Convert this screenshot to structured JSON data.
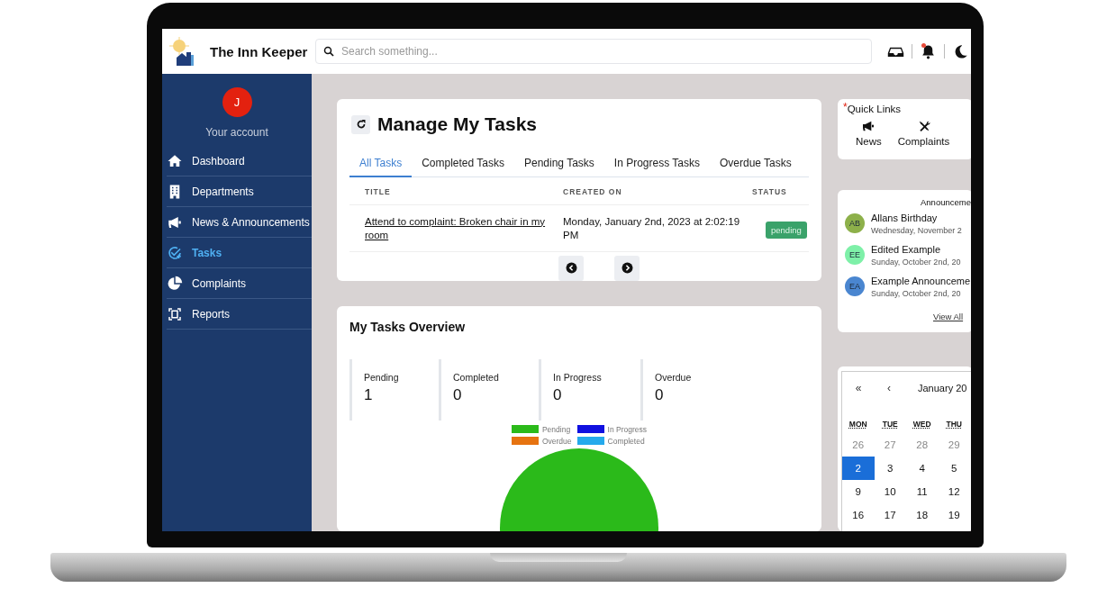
{
  "app": {
    "title": "The Inn Keeper"
  },
  "search": {
    "placeholder": "Search something..."
  },
  "header_icons": [
    {
      "kind": "inbox",
      "notification": false
    },
    {
      "kind": "bell",
      "notification": true
    },
    {
      "kind": "moon",
      "notification": false
    }
  ],
  "account": {
    "initial": "J",
    "label": "Your account"
  },
  "sidebar": {
    "items": [
      {
        "label": "Dashboard",
        "kind": "home",
        "selected": false
      },
      {
        "label": "Departments",
        "kind": "building",
        "selected": false
      },
      {
        "label": "News & Announcements",
        "kind": "megaphone",
        "selected": false
      },
      {
        "label": "Tasks",
        "kind": "task",
        "selected": true
      },
      {
        "label": "Complaints",
        "kind": "pie",
        "selected": false
      },
      {
        "label": "Reports",
        "kind": "report",
        "selected": false
      }
    ]
  },
  "tasks_card": {
    "title": "Manage My Tasks",
    "tabs": [
      {
        "label": "All Tasks",
        "selected": true
      },
      {
        "label": "Completed Tasks",
        "selected": false
      },
      {
        "label": "Pending Tasks",
        "selected": false
      },
      {
        "label": "In Progress Tasks",
        "selected": false
      },
      {
        "label": "Overdue Tasks",
        "selected": false
      }
    ],
    "table": {
      "columns": [
        "TITLE",
        "CREATED ON",
        "STATUS"
      ],
      "rows": [
        {
          "title": "Attend to complaint: Broken chair in my room",
          "created_on": "Monday, January 2nd, 2023 at 2:02:19 PM",
          "status": "pending"
        }
      ]
    }
  },
  "overview": {
    "title": "My Tasks Overview",
    "stats": [
      {
        "label": "Pending",
        "value": "1"
      },
      {
        "label": "Completed",
        "value": "0"
      },
      {
        "label": "In Progress",
        "value": "0"
      },
      {
        "label": "Overdue",
        "value": "0"
      }
    ],
    "legend": [
      {
        "label": "Pending",
        "color": "#2bba1a"
      },
      {
        "label": "In Progress",
        "color": "#1010e0"
      },
      {
        "label": "Overdue",
        "color": "#e67310"
      },
      {
        "label": "Completed",
        "color": "#25aaec"
      }
    ]
  },
  "quick_links": {
    "marker": "*",
    "title": "Quick Links",
    "items": [
      {
        "label": "News",
        "kind": "megaphone"
      },
      {
        "label": "Complaints",
        "kind": "tools"
      }
    ]
  },
  "announcements": {
    "title": "Announceme",
    "items": [
      {
        "initials": "AB",
        "color": "#8db04a",
        "title": "Allans Birthday",
        "date": "Wednesday, November 2"
      },
      {
        "initials": "EE",
        "color": "#7ef0a8",
        "title": "Edited Example",
        "date": "Sunday, October 2nd, 20"
      },
      {
        "initials": "EA",
        "color": "#4a86d0",
        "title": "Example Announceme",
        "date": "Sunday, October 2nd, 20"
      }
    ],
    "link": "View All"
  },
  "calendar": {
    "nav": [
      "«",
      "‹"
    ],
    "month": "January 20",
    "weekdays": [
      "MON",
      "TUE",
      "WED",
      "THU"
    ],
    "weeks": [
      [
        {
          "day": "26",
          "outside": true,
          "selected": false
        },
        {
          "day": "27",
          "outside": true,
          "selected": false
        },
        {
          "day": "28",
          "outside": true,
          "selected": false
        },
        {
          "day": "29",
          "outside": true,
          "selected": false
        }
      ],
      [
        {
          "day": "2",
          "outside": false,
          "selected": true
        },
        {
          "day": "3",
          "outside": false,
          "selected": false
        },
        {
          "day": "4",
          "outside": false,
          "selected": false
        },
        {
          "day": "5",
          "outside": false,
          "selected": false
        }
      ],
      [
        {
          "day": "9",
          "outside": false,
          "selected": false
        },
        {
          "day": "10",
          "outside": false,
          "selected": false
        },
        {
          "day": "11",
          "outside": false,
          "selected": false
        },
        {
          "day": "12",
          "outside": false,
          "selected": false
        }
      ],
      [
        {
          "day": "16",
          "outside": false,
          "selected": false
        },
        {
          "day": "17",
          "outside": false,
          "selected": false
        },
        {
          "day": "18",
          "outside": false,
          "selected": false
        },
        {
          "day": "19",
          "outside": false,
          "selected": false
        }
      ]
    ]
  }
}
